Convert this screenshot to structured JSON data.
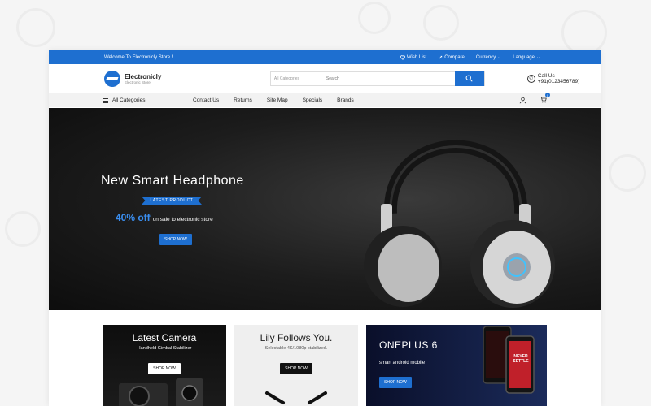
{
  "topbar": {
    "welcome": "Welcome To Electronicly Store !",
    "wishlist": "Wish List",
    "compare": "Compare",
    "currency": "Currency",
    "language": "Language"
  },
  "header": {
    "brand_name": "Electronicly",
    "brand_tagline": "Electronic Store",
    "search_category": "All Categories",
    "search_placeholder": "Search",
    "call_label": "Call Us : +91(0123456789)"
  },
  "nav": {
    "all_categories": "All Categories",
    "items": [
      "Contact Us",
      "Returns",
      "Site Map",
      "Specials",
      "Brands"
    ],
    "cart_count": "0"
  },
  "hero": {
    "title": "New Smart Headphone",
    "ribbon": "LATEST PRODUCT",
    "offer_pct": "40% off",
    "offer_text": "on sale to electronic store",
    "button": "SHOP NOW"
  },
  "banners": {
    "camera": {
      "title": "Latest Camera",
      "subtitle": "Handheld Gimbal Stabilizer",
      "button": "SHOP NOW"
    },
    "lily": {
      "title": "Lily Follows You.",
      "subtitle": "Selectable 4K/1080p stabilized.",
      "button": "SHOP NOW"
    },
    "oneplus": {
      "title": "ONEPLUS 6",
      "subtitle": "smart android mobile",
      "button": "SHOP NOW",
      "phone_text": "NEVER SETTLE"
    }
  },
  "colors": {
    "accent": "#1e6fd0",
    "hero_bg": "#1c1c1c"
  }
}
